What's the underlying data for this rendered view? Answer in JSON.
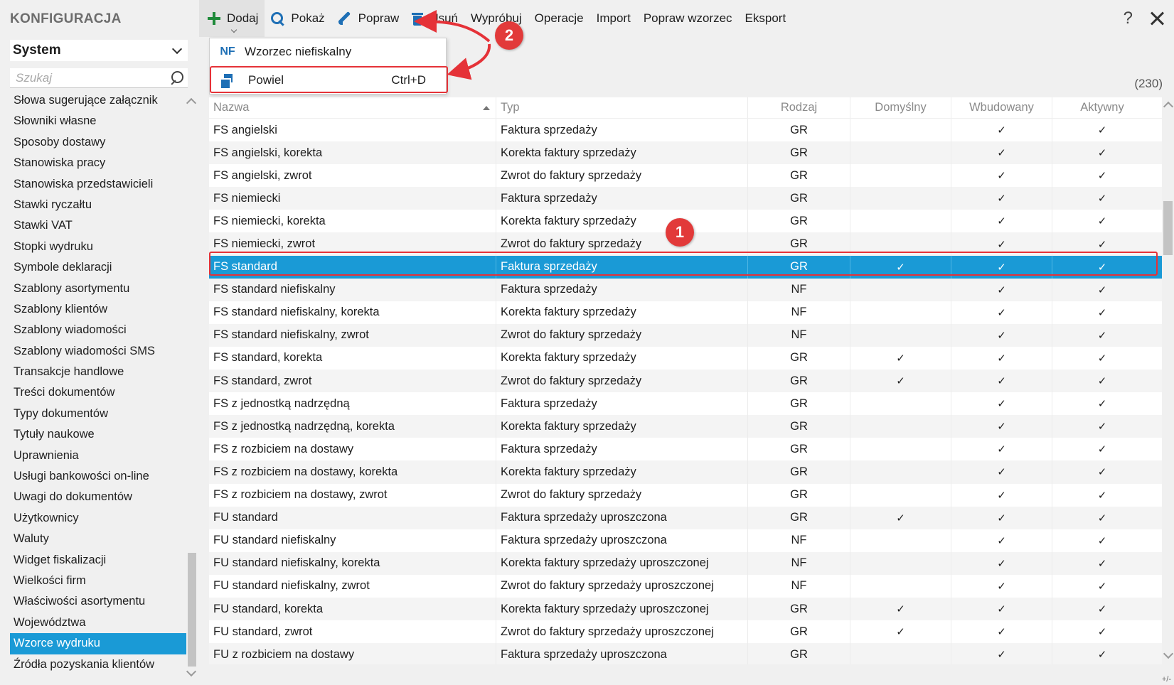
{
  "sidebar": {
    "app_title": "KONFIGURACJA",
    "module": "System",
    "search_placeholder": "Szukaj",
    "items": [
      "Słowa sugerujące załącznik",
      "Słowniki własne",
      "Sposoby dostawy",
      "Stanowiska pracy",
      "Stanowiska przedstawicieli",
      "Stawki ryczałtu",
      "Stawki VAT",
      "Stopki wydruku",
      "Symbole deklaracji",
      "Szablony asortymentu",
      "Szablony klientów",
      "Szablony wiadomości",
      "Szablony wiadomości SMS",
      "Transakcje handlowe",
      "Treści dokumentów",
      "Typy dokumentów",
      "Tytuły naukowe",
      "Uprawnienia",
      "Usługi bankowości on-line",
      "Uwagi do dokumentów",
      "Użytkownicy",
      "Waluty",
      "Widget fiskalizacji",
      "Wielkości firm",
      "Właściwości asortymentu",
      "Województwa",
      "Wzorce wydruku",
      "Źródła pozyskania klientów"
    ],
    "active_index": 26
  },
  "toolbar": {
    "add": "Dodaj",
    "show": "Pokaż",
    "edit": "Popraw",
    "delete": "Usuń",
    "try": "Wypróbuj",
    "operations": "Operacje",
    "import": "Import",
    "edit_template": "Popraw wzorzec",
    "export": "Eksport",
    "help": "?"
  },
  "dropdown": {
    "item1_badge": "NF",
    "item1_label": "Wzorzec niefiskalny",
    "item2_label": "Powiel",
    "item2_shortcut": "Ctrl+D"
  },
  "grid": {
    "count": "(230)",
    "headers": {
      "name": "Nazwa",
      "type": "Typ",
      "kind": "Rodzaj",
      "default": "Domyślny",
      "builtin": "Wbudowany",
      "active": "Aktywny"
    },
    "check_glyph": "✓",
    "selected_index": 6,
    "rows": [
      {
        "name": "FS angielski",
        "type": "Faktura sprzedaży",
        "kind": "GR",
        "def": false,
        "built": true,
        "act": true
      },
      {
        "name": "FS angielski, korekta",
        "type": "Korekta faktury sprzedaży",
        "kind": "GR",
        "def": false,
        "built": true,
        "act": true
      },
      {
        "name": "FS angielski, zwrot",
        "type": "Zwrot do faktury sprzedaży",
        "kind": "GR",
        "def": false,
        "built": true,
        "act": true
      },
      {
        "name": "FS niemiecki",
        "type": "Faktura sprzedaży",
        "kind": "GR",
        "def": false,
        "built": true,
        "act": true
      },
      {
        "name": "FS niemiecki, korekta",
        "type": "Korekta faktury sprzedaży",
        "kind": "GR",
        "def": false,
        "built": true,
        "act": true
      },
      {
        "name": "FS niemiecki, zwrot",
        "type": "Zwrot do faktury sprzedaży",
        "kind": "GR",
        "def": false,
        "built": true,
        "act": true
      },
      {
        "name": "FS standard",
        "type": "Faktura sprzedaży",
        "kind": "GR",
        "def": true,
        "built": true,
        "act": true
      },
      {
        "name": "FS standard niefiskalny",
        "type": "Faktura sprzedaży",
        "kind": "NF",
        "def": false,
        "built": true,
        "act": true
      },
      {
        "name": "FS standard niefiskalny, korekta",
        "type": "Korekta faktury sprzedaży",
        "kind": "NF",
        "def": false,
        "built": true,
        "act": true
      },
      {
        "name": "FS standard niefiskalny, zwrot",
        "type": "Zwrot do faktury sprzedaży",
        "kind": "NF",
        "def": false,
        "built": true,
        "act": true
      },
      {
        "name": "FS standard, korekta",
        "type": "Korekta faktury sprzedaży",
        "kind": "GR",
        "def": true,
        "built": true,
        "act": true
      },
      {
        "name": "FS standard, zwrot",
        "type": "Zwrot do faktury sprzedaży",
        "kind": "GR",
        "def": true,
        "built": true,
        "act": true
      },
      {
        "name": "FS z jednostką nadrzędną",
        "type": "Faktura sprzedaży",
        "kind": "GR",
        "def": false,
        "built": true,
        "act": true
      },
      {
        "name": "FS z jednostką nadrzędną, korekta",
        "type": "Korekta faktury sprzedaży",
        "kind": "GR",
        "def": false,
        "built": true,
        "act": true
      },
      {
        "name": "FS z rozbiciem na dostawy",
        "type": "Faktura sprzedaży",
        "kind": "GR",
        "def": false,
        "built": true,
        "act": true
      },
      {
        "name": "FS z rozbiciem na dostawy, korekta",
        "type": "Korekta faktury sprzedaży",
        "kind": "GR",
        "def": false,
        "built": true,
        "act": true
      },
      {
        "name": "FS z rozbiciem na dostawy, zwrot",
        "type": "Zwrot do faktury sprzedaży",
        "kind": "GR",
        "def": false,
        "built": true,
        "act": true
      },
      {
        "name": "FU standard",
        "type": "Faktura sprzedaży uproszczona",
        "kind": "GR",
        "def": true,
        "built": true,
        "act": true
      },
      {
        "name": "FU standard niefiskalny",
        "type": "Faktura sprzedaży uproszczona",
        "kind": "NF",
        "def": false,
        "built": true,
        "act": true
      },
      {
        "name": "FU standard niefiskalny, korekta",
        "type": "Korekta faktury sprzedaży uproszczonej",
        "kind": "NF",
        "def": false,
        "built": true,
        "act": true
      },
      {
        "name": "FU standard niefiskalny, zwrot",
        "type": "Zwrot do faktury sprzedaży uproszczonej",
        "kind": "NF",
        "def": false,
        "built": true,
        "act": true
      },
      {
        "name": "FU standard, korekta",
        "type": "Korekta faktury sprzedaży uproszczonej",
        "kind": "GR",
        "def": true,
        "built": true,
        "act": true
      },
      {
        "name": "FU standard, zwrot",
        "type": "Zwrot do faktury sprzedaży uproszczonej",
        "kind": "GR",
        "def": true,
        "built": true,
        "act": true
      },
      {
        "name": "FU z rozbiciem na dostawy",
        "type": "Faktura sprzedaży uproszczona",
        "kind": "GR",
        "def": false,
        "built": true,
        "act": true
      }
    ]
  },
  "annotations": {
    "badge1": "1",
    "badge2": "2"
  },
  "corner_label": "+/-",
  "colors": {
    "accent": "#1a9ad6",
    "highlight": "#e53238",
    "icon_blue": "#1e6fb5",
    "add_green": "#1f8a3a"
  }
}
